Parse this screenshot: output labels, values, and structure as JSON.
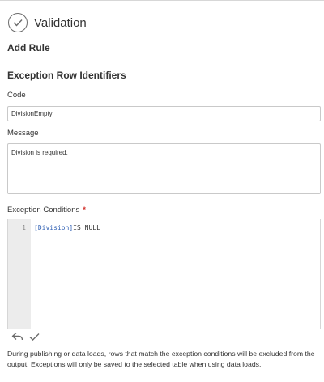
{
  "header": {
    "title": "Validation",
    "icon": "check-circle-icon"
  },
  "page": {
    "subtitle": "Add Rule"
  },
  "section": {
    "title": "Exception Row Identifiers"
  },
  "code": {
    "label": "Code",
    "value": "DivisionEmpty"
  },
  "message": {
    "label": "Message",
    "value": "Division is required."
  },
  "conditions": {
    "label": "Exception Conditions",
    "required_marker": "*",
    "line_number": "1",
    "field_ref": "[Division]",
    "expression_rest": "IS NULL"
  },
  "editor_actions": {
    "undo_icon": "undo-icon",
    "apply_icon": "check-icon"
  },
  "help": {
    "text": "During publishing or data loads, rows that match the exception conditions will be excluded from the output. Exceptions will only be saved to the selected table when using data loads."
  },
  "colors": {
    "required": "#d2322d",
    "field_ref": "#2f5fb3",
    "gutter": "#ececec"
  }
}
